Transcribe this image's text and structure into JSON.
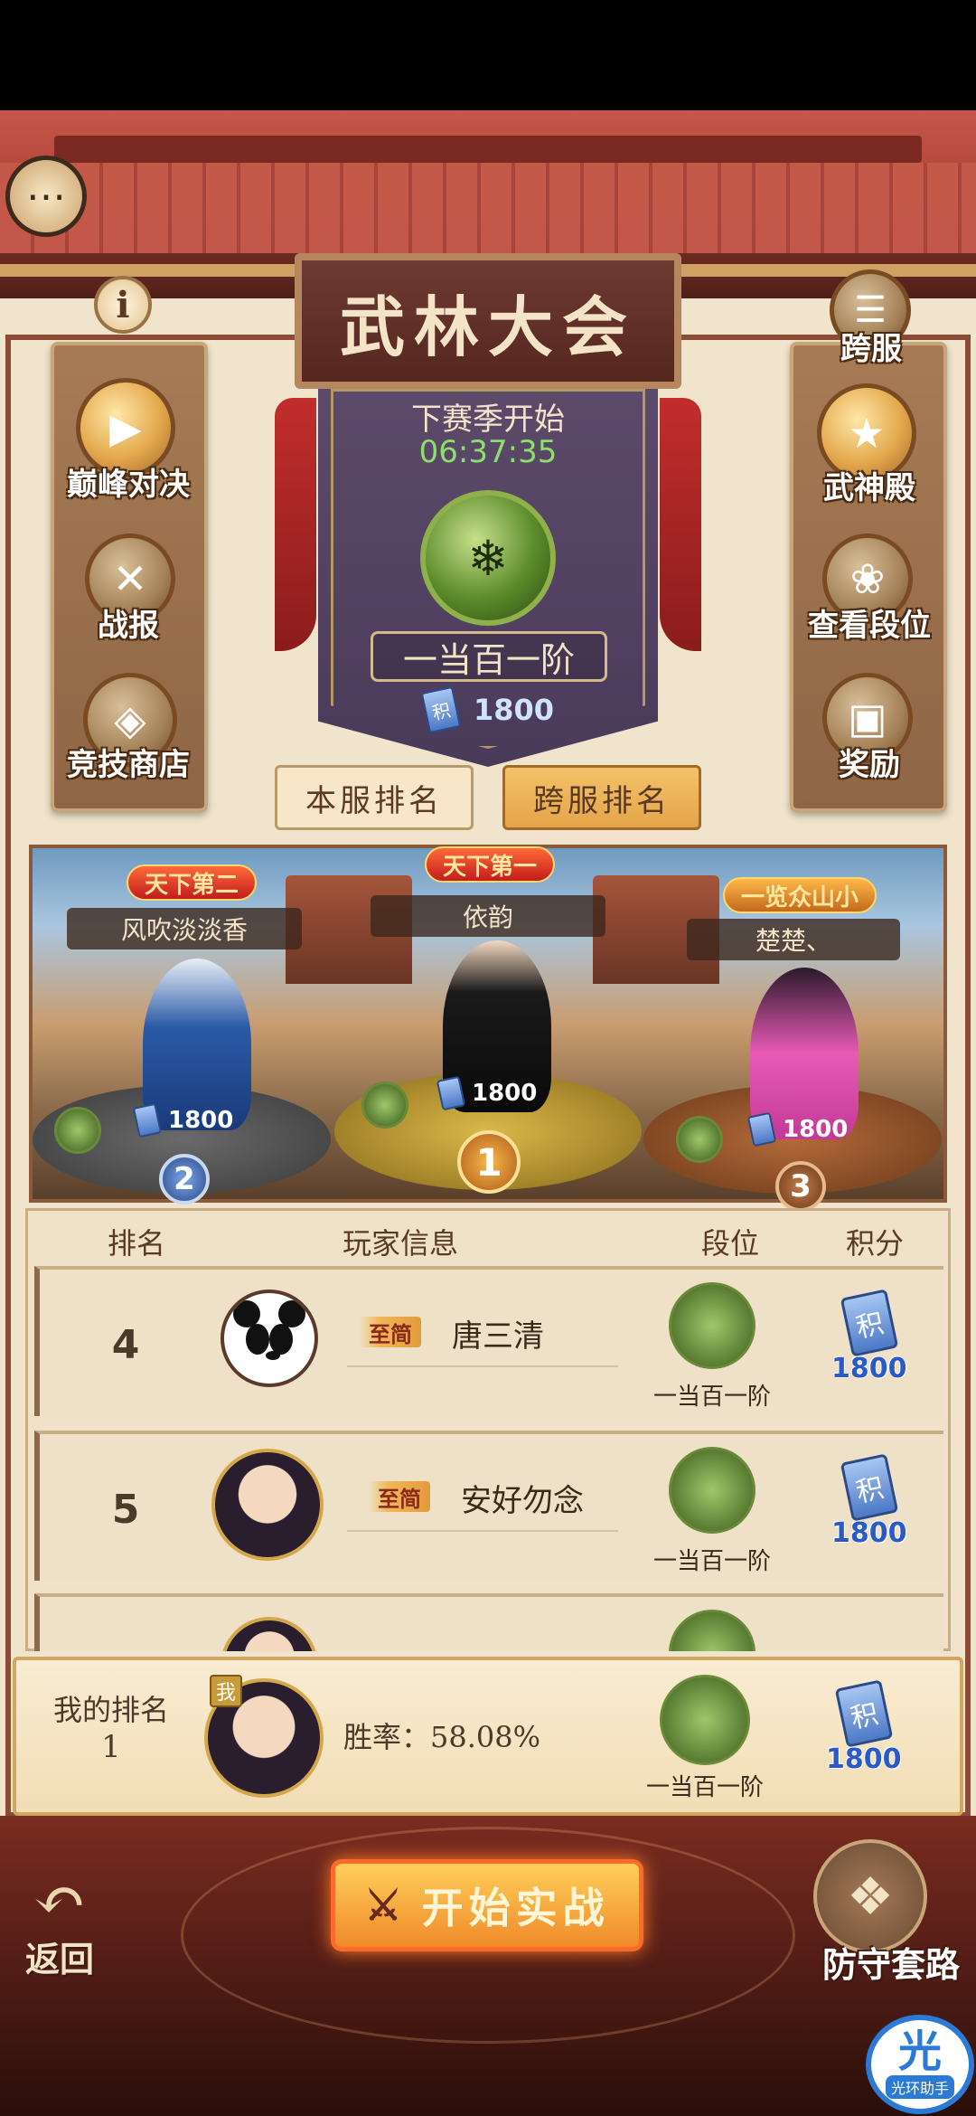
{
  "header": {
    "title": "武林大会",
    "cross_server_label": "跨服"
  },
  "season": {
    "label": "下赛季开始",
    "countdown": "06:37:35",
    "tier": "一当百一阶",
    "score_icon_text": "积",
    "score": "1800"
  },
  "left_menu": [
    {
      "label": "巅峰对决",
      "icon": "play-icon"
    },
    {
      "label": "战报",
      "icon": "scroll-icon"
    },
    {
      "label": "竞技商店",
      "icon": "shop-icon"
    }
  ],
  "right_menu": [
    {
      "label": "武神殿",
      "icon": "shield-icon"
    },
    {
      "label": "查看段位",
      "icon": "dragon-icon"
    },
    {
      "label": "奖励",
      "icon": "chest-icon"
    }
  ],
  "tabs": {
    "local": "本服排名",
    "cross": "跨服排名"
  },
  "podium": {
    "first": {
      "rank": "1",
      "name": "依韵",
      "title": "天下第一",
      "score": "1800"
    },
    "second": {
      "rank": "2",
      "name": "风吹淡淡香",
      "title": "天下第二",
      "score": "1800"
    },
    "third": {
      "rank": "3",
      "name": "楚楚、",
      "title": "一览众山小",
      "score": "1800"
    }
  },
  "table": {
    "headers": [
      "排名",
      "玩家信息",
      "段位",
      "积分"
    ],
    "rows": [
      {
        "rank": "4",
        "vip": "至简",
        "name": "唐三清",
        "tier": "一当百一阶",
        "score": "1800",
        "avatar": "panda"
      },
      {
        "rank": "5",
        "vip": "至简",
        "name": "安好勿念",
        "tier": "一当百一阶",
        "score": "1800",
        "avatar": "person"
      }
    ]
  },
  "my_rank": {
    "label": "我的排名",
    "rank": "1",
    "me_tag": "我",
    "winrate_label": "胜率：58.08%",
    "tier": "一当百一阶",
    "score": "1800"
  },
  "bottom": {
    "back_label": "返回",
    "start_label": "开始实战",
    "defense_label": "防守套路",
    "helper_glyph": "光",
    "helper_text": "光环助手"
  },
  "colors": {
    "roof": "#b04637",
    "wall": "#f1e4cc",
    "countdown": "#8be06b",
    "accent_tab": "#e5a44a",
    "score_blue": "#2a5ac6"
  }
}
